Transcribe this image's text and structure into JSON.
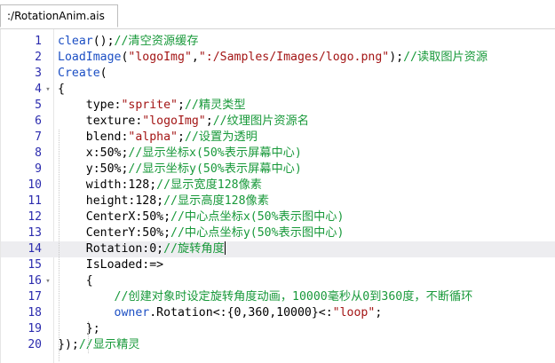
{
  "tab": {
    "title": ":/RotationAnim.ais"
  },
  "lines": [
    {
      "n": "1",
      "tokens": [
        {
          "t": "clear",
          "c": "kw"
        },
        {
          "t": "();",
          "c": ""
        },
        {
          "t": "//清空资源缓存",
          "c": "cm"
        }
      ]
    },
    {
      "n": "2",
      "tokens": [
        {
          "t": "LoadImage",
          "c": "kw"
        },
        {
          "t": "(",
          "c": ""
        },
        {
          "t": "\"logoImg\"",
          "c": "str"
        },
        {
          "t": ",",
          "c": ""
        },
        {
          "t": "\":/Samples/Images/logo.png\"",
          "c": "str"
        },
        {
          "t": ");",
          "c": ""
        },
        {
          "t": "//读取图片资源",
          "c": "cm"
        }
      ]
    },
    {
      "n": "3",
      "tokens": [
        {
          "t": "Create",
          "c": "kw"
        },
        {
          "t": "(",
          "c": ""
        }
      ]
    },
    {
      "n": "4",
      "fold": "▾",
      "tokens": [
        {
          "t": "{",
          "c": ""
        }
      ]
    },
    {
      "n": "5",
      "tokens": [
        {
          "t": "    type:",
          "c": ""
        },
        {
          "t": "\"sprite\"",
          "c": "str"
        },
        {
          "t": ";",
          "c": ""
        },
        {
          "t": "//精灵类型",
          "c": "cm"
        }
      ]
    },
    {
      "n": "6",
      "tokens": [
        {
          "t": "    texture:",
          "c": ""
        },
        {
          "t": "\"logoImg\"",
          "c": "str"
        },
        {
          "t": ";",
          "c": ""
        },
        {
          "t": "//纹理图片资源名",
          "c": "cm"
        }
      ]
    },
    {
      "n": "7",
      "tokens": [
        {
          "t": "    blend:",
          "c": ""
        },
        {
          "t": "\"alpha\"",
          "c": "str"
        },
        {
          "t": ";",
          "c": ""
        },
        {
          "t": "//设置为透明",
          "c": "cm"
        }
      ]
    },
    {
      "n": "8",
      "tokens": [
        {
          "t": "    x:50%;",
          "c": ""
        },
        {
          "t": "//显示坐标x(50%表示屏幕中心)",
          "c": "cm"
        }
      ]
    },
    {
      "n": "9",
      "tokens": [
        {
          "t": "    y:50%;",
          "c": ""
        },
        {
          "t": "//显示坐标y(50%表示屏幕中心)",
          "c": "cm"
        }
      ]
    },
    {
      "n": "10",
      "tokens": [
        {
          "t": "    width:128;",
          "c": ""
        },
        {
          "t": "//显示宽度128像素",
          "c": "cm"
        }
      ]
    },
    {
      "n": "11",
      "tokens": [
        {
          "t": "    height:128;",
          "c": ""
        },
        {
          "t": "//显示高度128像素",
          "c": "cm"
        }
      ]
    },
    {
      "n": "12",
      "tokens": [
        {
          "t": "    CenterX:50%;",
          "c": ""
        },
        {
          "t": "//中心点坐标x(50%表示图中心)",
          "c": "cm"
        }
      ]
    },
    {
      "n": "13",
      "tokens": [
        {
          "t": "    CenterY:50%;",
          "c": ""
        },
        {
          "t": "//中心点坐标y(50%表示图中心)",
          "c": "cm"
        }
      ]
    },
    {
      "n": "14",
      "current": true,
      "tokens": [
        {
          "t": "    Rotation:0;",
          "c": ""
        },
        {
          "t": "//旋转角度",
          "c": "cm"
        }
      ]
    },
    {
      "n": "15",
      "tokens": [
        {
          "t": "    IsLoaded:=>",
          "c": ""
        }
      ]
    },
    {
      "n": "16",
      "fold": "▾",
      "tokens": [
        {
          "t": "    {",
          "c": ""
        }
      ]
    },
    {
      "n": "17",
      "tokens": [
        {
          "t": "        ",
          "c": ""
        },
        {
          "t": "//创建对象时设定旋转角度动画，10000毫秒从0到360度，不断循环",
          "c": "cm"
        }
      ]
    },
    {
      "n": "18",
      "tokens": [
        {
          "t": "        ",
          "c": ""
        },
        {
          "t": "owner",
          "c": "kw"
        },
        {
          "t": ".Rotation<:{0,360,10000}<:",
          "c": ""
        },
        {
          "t": "\"loop\"",
          "c": "str"
        },
        {
          "t": ";",
          "c": ""
        }
      ]
    },
    {
      "n": "19",
      "tokens": [
        {
          "t": "    };",
          "c": ""
        }
      ]
    },
    {
      "n": "20",
      "tokens": [
        {
          "t": "});",
          "c": ""
        },
        {
          "t": "//显示精灵",
          "c": "cm"
        }
      ]
    }
  ],
  "colors": {
    "keyword": "#1c4fc4",
    "string": "#a31515",
    "comment": "#18993a",
    "line_number": "#2b2bae",
    "current_line": "#ededf0"
  }
}
